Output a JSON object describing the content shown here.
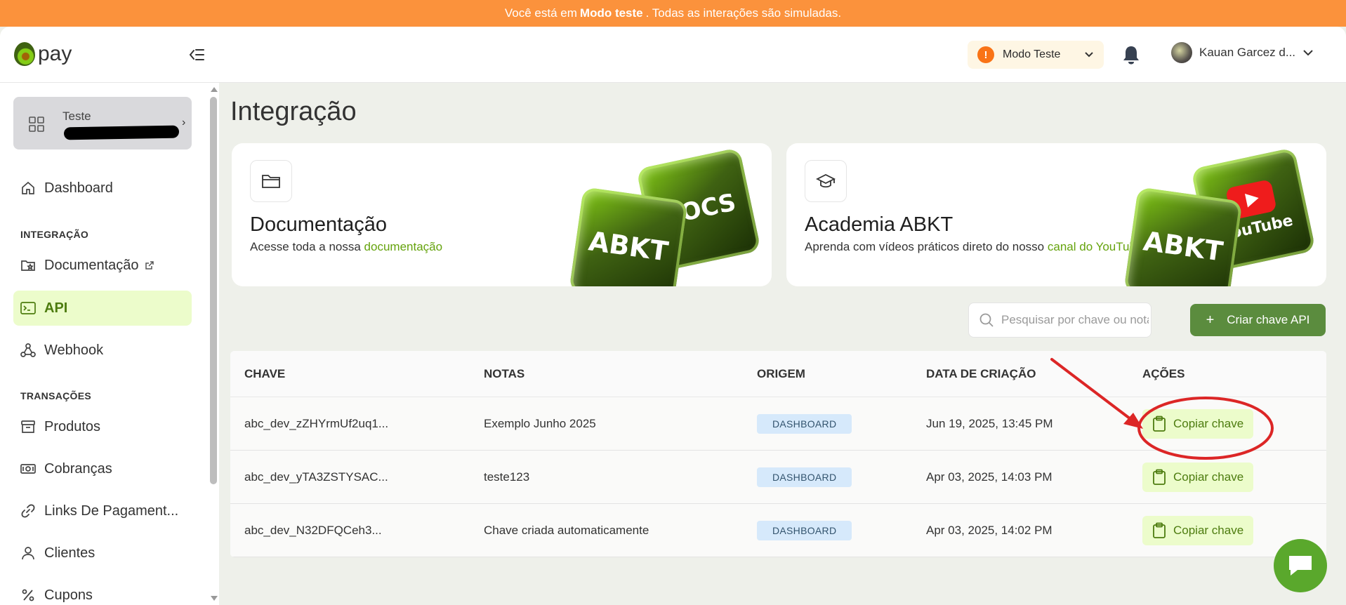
{
  "banner": {
    "prefix": "Você está em",
    "bold": "Modo teste",
    "suffix": ". Todas as interações são simuladas."
  },
  "header": {
    "logo_text": "pay",
    "mode_label": "Modo Teste",
    "mode_icon": "!",
    "user_name": "Kauan Garcez d..."
  },
  "sidebar": {
    "org_name": "Teste",
    "sections": {
      "integration": "INTEGRAÇÃO",
      "transactions": "TRANSAÇÕES"
    },
    "items": {
      "dashboard": "Dashboard",
      "documentation": "Documentação",
      "api": "API",
      "webhook": "Webhook",
      "products": "Produtos",
      "charges": "Cobranças",
      "payment_links": "Links De Pagament...",
      "clients": "Clientes",
      "coupons": "Cupons"
    }
  },
  "main": {
    "title": "Integração",
    "cards": [
      {
        "title": "Documentação",
        "desc": "Acesse toda a nossa ",
        "link": "documentação",
        "cube_a": "ABKT",
        "cube_b": "DOCS"
      },
      {
        "title": "Academia ABKT",
        "desc": "Aprenda com vídeos práticos direto do nosso ",
        "link": "canal do YouTube",
        "cube_a": "ABKT",
        "cube_b": "YouTube"
      }
    ],
    "search_placeholder": "Pesquisar por chave ou notas",
    "create_button": "Criar chave API",
    "create_icon": "+",
    "table": {
      "headers": [
        "CHAVE",
        "NOTAS",
        "ORIGEM",
        "DATA DE CRIAÇÃO",
        "AÇÕES"
      ],
      "rows": [
        {
          "key": "abc_dev_zZHYrmUf2uq1...",
          "notes": "Exemplo Junho 2025",
          "origin": "DASHBOARD",
          "created": "Jun 19, 2025, 13:45 PM",
          "action": "Copiar chave"
        },
        {
          "key": "abc_dev_yTA3ZSTYSAC...",
          "notes": "teste123",
          "origin": "DASHBOARD",
          "created": "Apr 03, 2025, 14:03 PM",
          "action": "Copiar chave"
        },
        {
          "key": "abc_dev_N32DFQCeh3...",
          "notes": "Chave criada automaticamente",
          "origin": "DASHBOARD",
          "created": "Apr 03, 2025, 14:02 PM",
          "action": "Copiar chave"
        }
      ]
    }
  },
  "colors": {
    "banner": "#fb923c",
    "accent": "#5b8c3e",
    "active_bg": "#ecfccb",
    "annotation": "#dc2626"
  }
}
